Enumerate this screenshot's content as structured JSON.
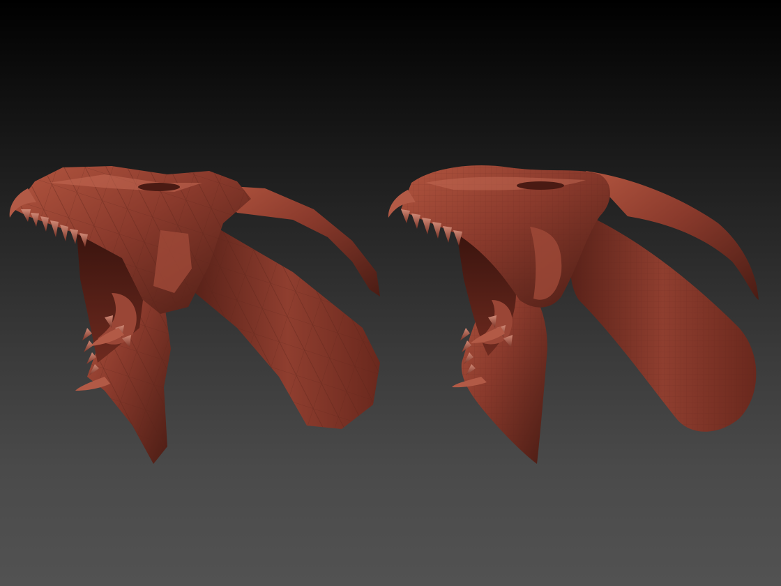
{
  "scene": {
    "background_top": "#000000",
    "background_bottom": "#525252",
    "material_color": "#8a3a2c",
    "material_highlight": "#c0624e",
    "material_shadow": "#3a1510",
    "tooth_color": "#b8705e"
  },
  "models": [
    {
      "id": "low-poly",
      "shading": "faceted"
    },
    {
      "id": "subdivided",
      "shading": "smooth-wireframe"
    }
  ]
}
